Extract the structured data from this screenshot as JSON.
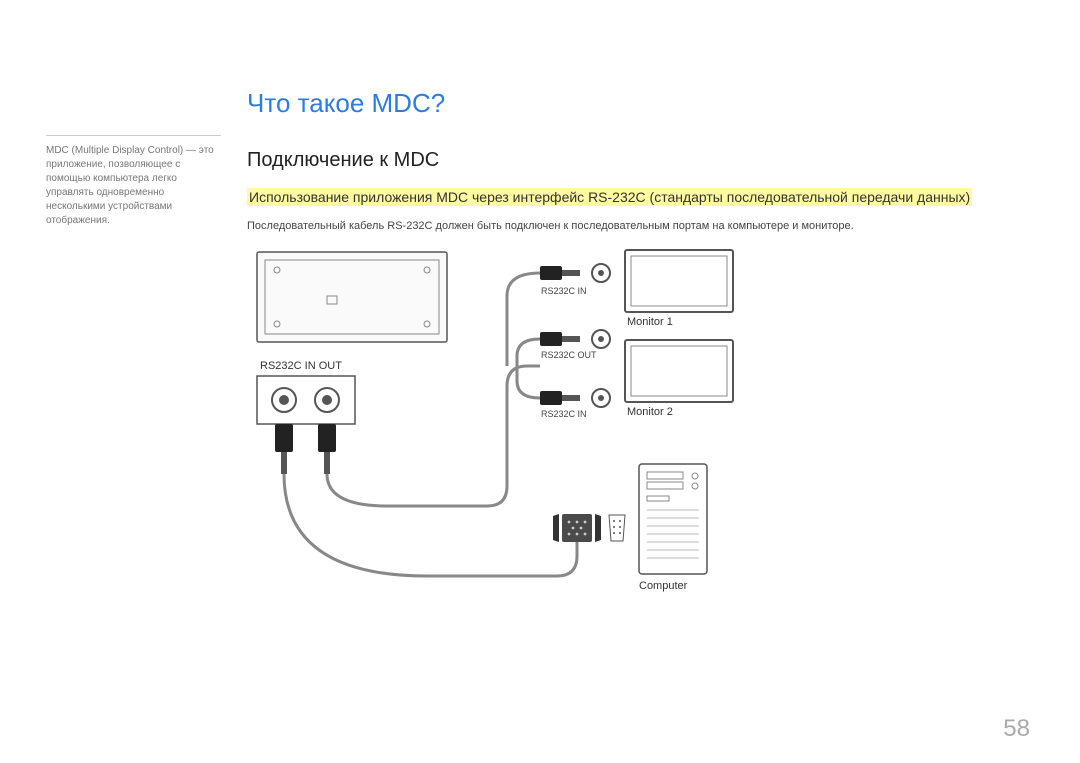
{
  "sidebar": {
    "note": "MDC (Multiple Display Control) — это приложение, позволяющее с помощью компьютера легко управлять одновременно несколькими устройствами отображения."
  },
  "main": {
    "title": "Что такое MDC?",
    "section_title": "Подключение к MDC",
    "highlight": "Использование приложения MDC через интерфейс RS-232C (стандарты последовательной передачи данных)",
    "body": "Последовательный кабель RS-232C должен быть подключен к последовательным портам на компьютере и мониторе."
  },
  "diagram": {
    "port_label": "RS232C IN OUT",
    "cable_in": "RS232C IN",
    "cable_out": "RS232C OUT",
    "monitor1": "Monitor 1",
    "monitor2": "Monitor 2",
    "computer": "Computer"
  },
  "page_number": "58"
}
